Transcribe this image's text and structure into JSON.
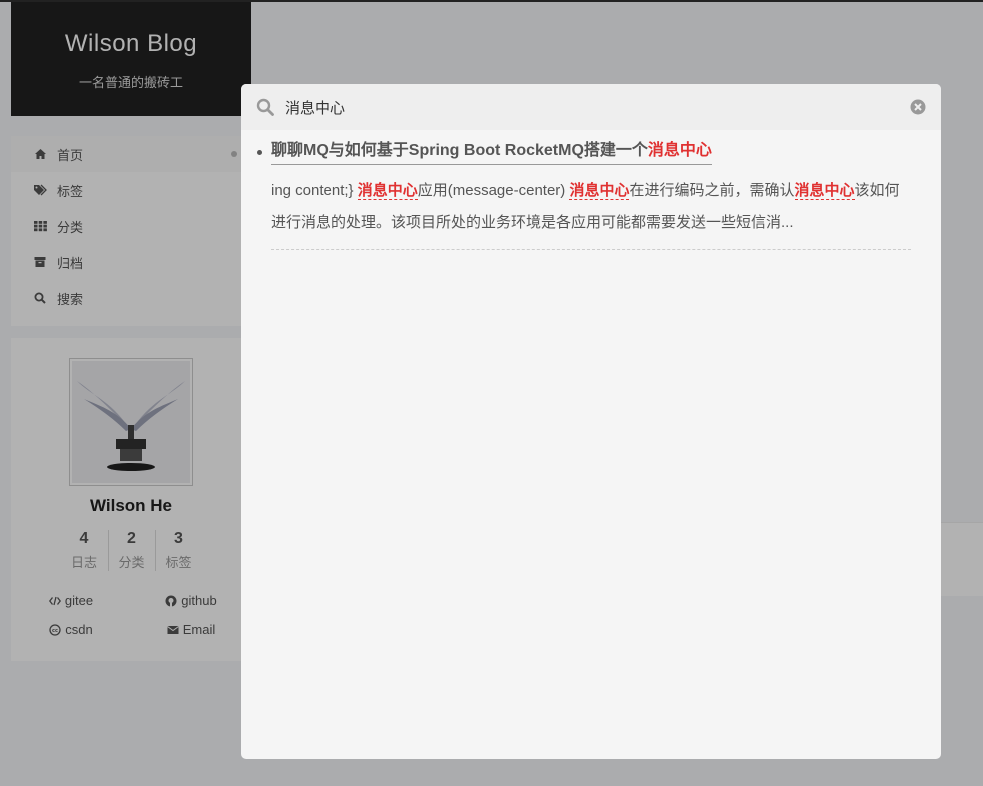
{
  "site": {
    "title": "Wilson Blog",
    "subtitle": "一名普通的搬砖工"
  },
  "menu": {
    "items": [
      {
        "label": "首页",
        "icon": "home-icon"
      },
      {
        "label": "标签",
        "icon": "tags-icon"
      },
      {
        "label": "分类",
        "icon": "grid-icon"
      },
      {
        "label": "归档",
        "icon": "archive-icon"
      },
      {
        "label": "搜索",
        "icon": "search-icon"
      }
    ]
  },
  "author": {
    "name": "Wilson He",
    "stats": [
      {
        "count": "4",
        "label": "日志"
      },
      {
        "count": "2",
        "label": "分类"
      },
      {
        "count": "3",
        "label": "标签"
      }
    ],
    "links": [
      {
        "label": "gitee",
        "icon": "code-icon"
      },
      {
        "label": "github",
        "icon": "github-icon"
      },
      {
        "label": "csdn",
        "icon": "creative-commons-icon"
      },
      {
        "label": "Email",
        "icon": "envelope-icon"
      }
    ]
  },
  "search": {
    "query": "消息中心",
    "results": [
      {
        "title_prefix": "聊聊MQ与如何基于Spring Boot RocketMQ搭建一个",
        "title_highlight": "消息中心",
        "excerpt": {
          "t1": "ing content;} ",
          "h1": "消息中心",
          "t2": "应用(message-center) ",
          "h2": "消息中心",
          "t3": "在进行编码之前，需确认",
          "h3": "消息中心",
          "t4": "该如何进行消息的处理。该项目所处的业务环境是各应用可能都需要发送一些短信消..."
        }
      }
    ]
  },
  "colors": {
    "highlight": "#e03131",
    "brand_bg": "#222222"
  }
}
